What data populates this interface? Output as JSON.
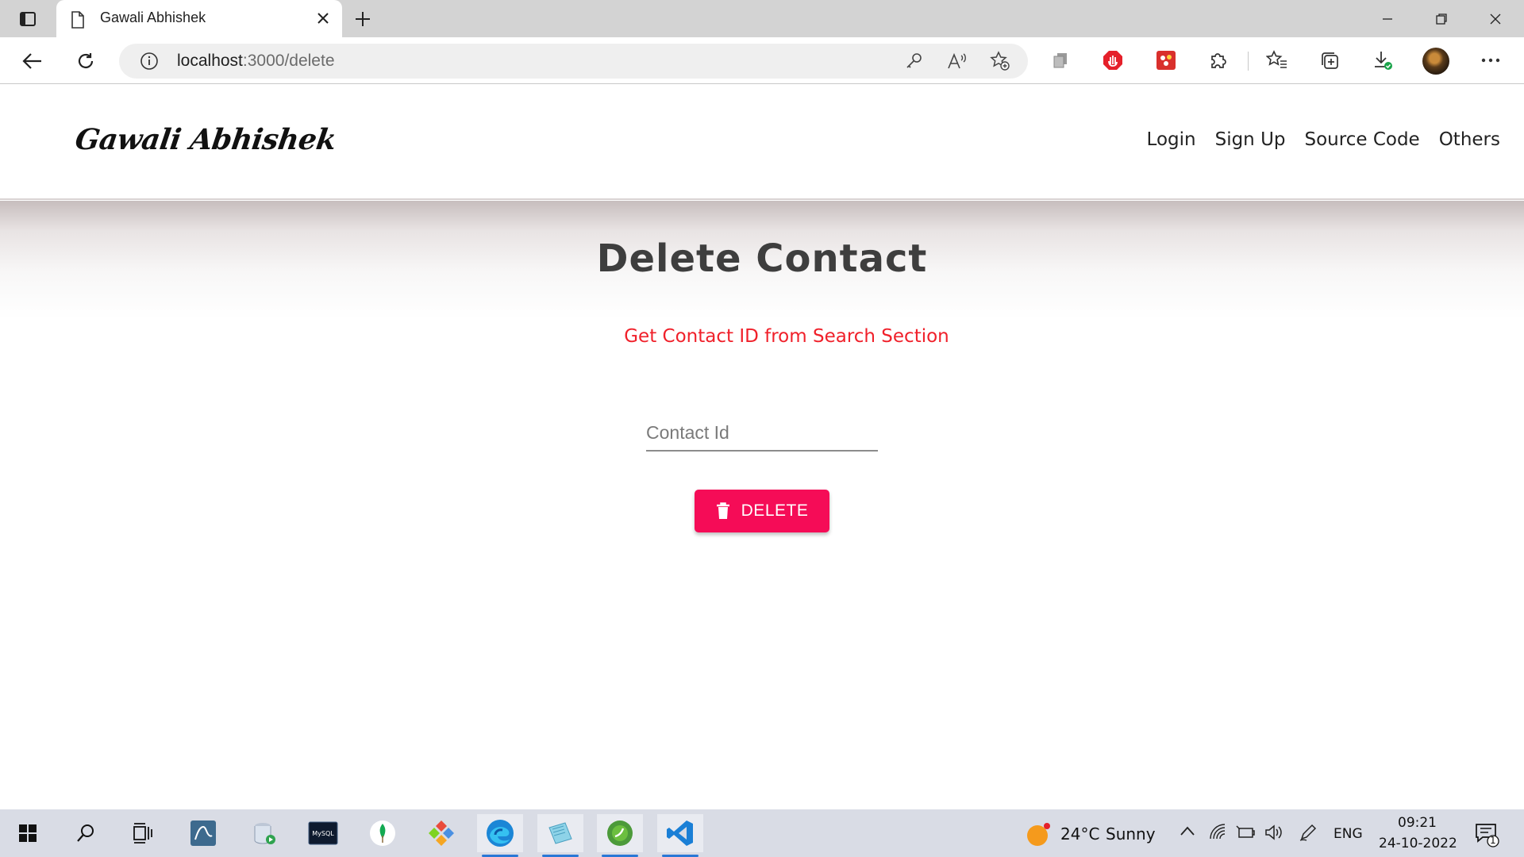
{
  "browser": {
    "tab_title": "Gawali Abhishek",
    "url_host": "localhost",
    "url_path": ":3000/delete"
  },
  "site": {
    "brand": "Gawali Abhishek",
    "nav": [
      "Login",
      "Sign Up",
      "Source Code",
      "Others"
    ]
  },
  "main": {
    "title": "Delete Contact",
    "hint": "Get Contact ID from Search Section",
    "contact_id_placeholder": "Contact Id",
    "contact_id_value": "",
    "delete_label": "DELETE"
  },
  "taskbar": {
    "weather_temp": "24°C",
    "weather_desc": "Sunny",
    "language": "ENG",
    "time": "09:21",
    "date": "24-10-2022",
    "notification_count": "1"
  },
  "colors": {
    "accent": "#f50c57",
    "hint": "#f0202a"
  }
}
